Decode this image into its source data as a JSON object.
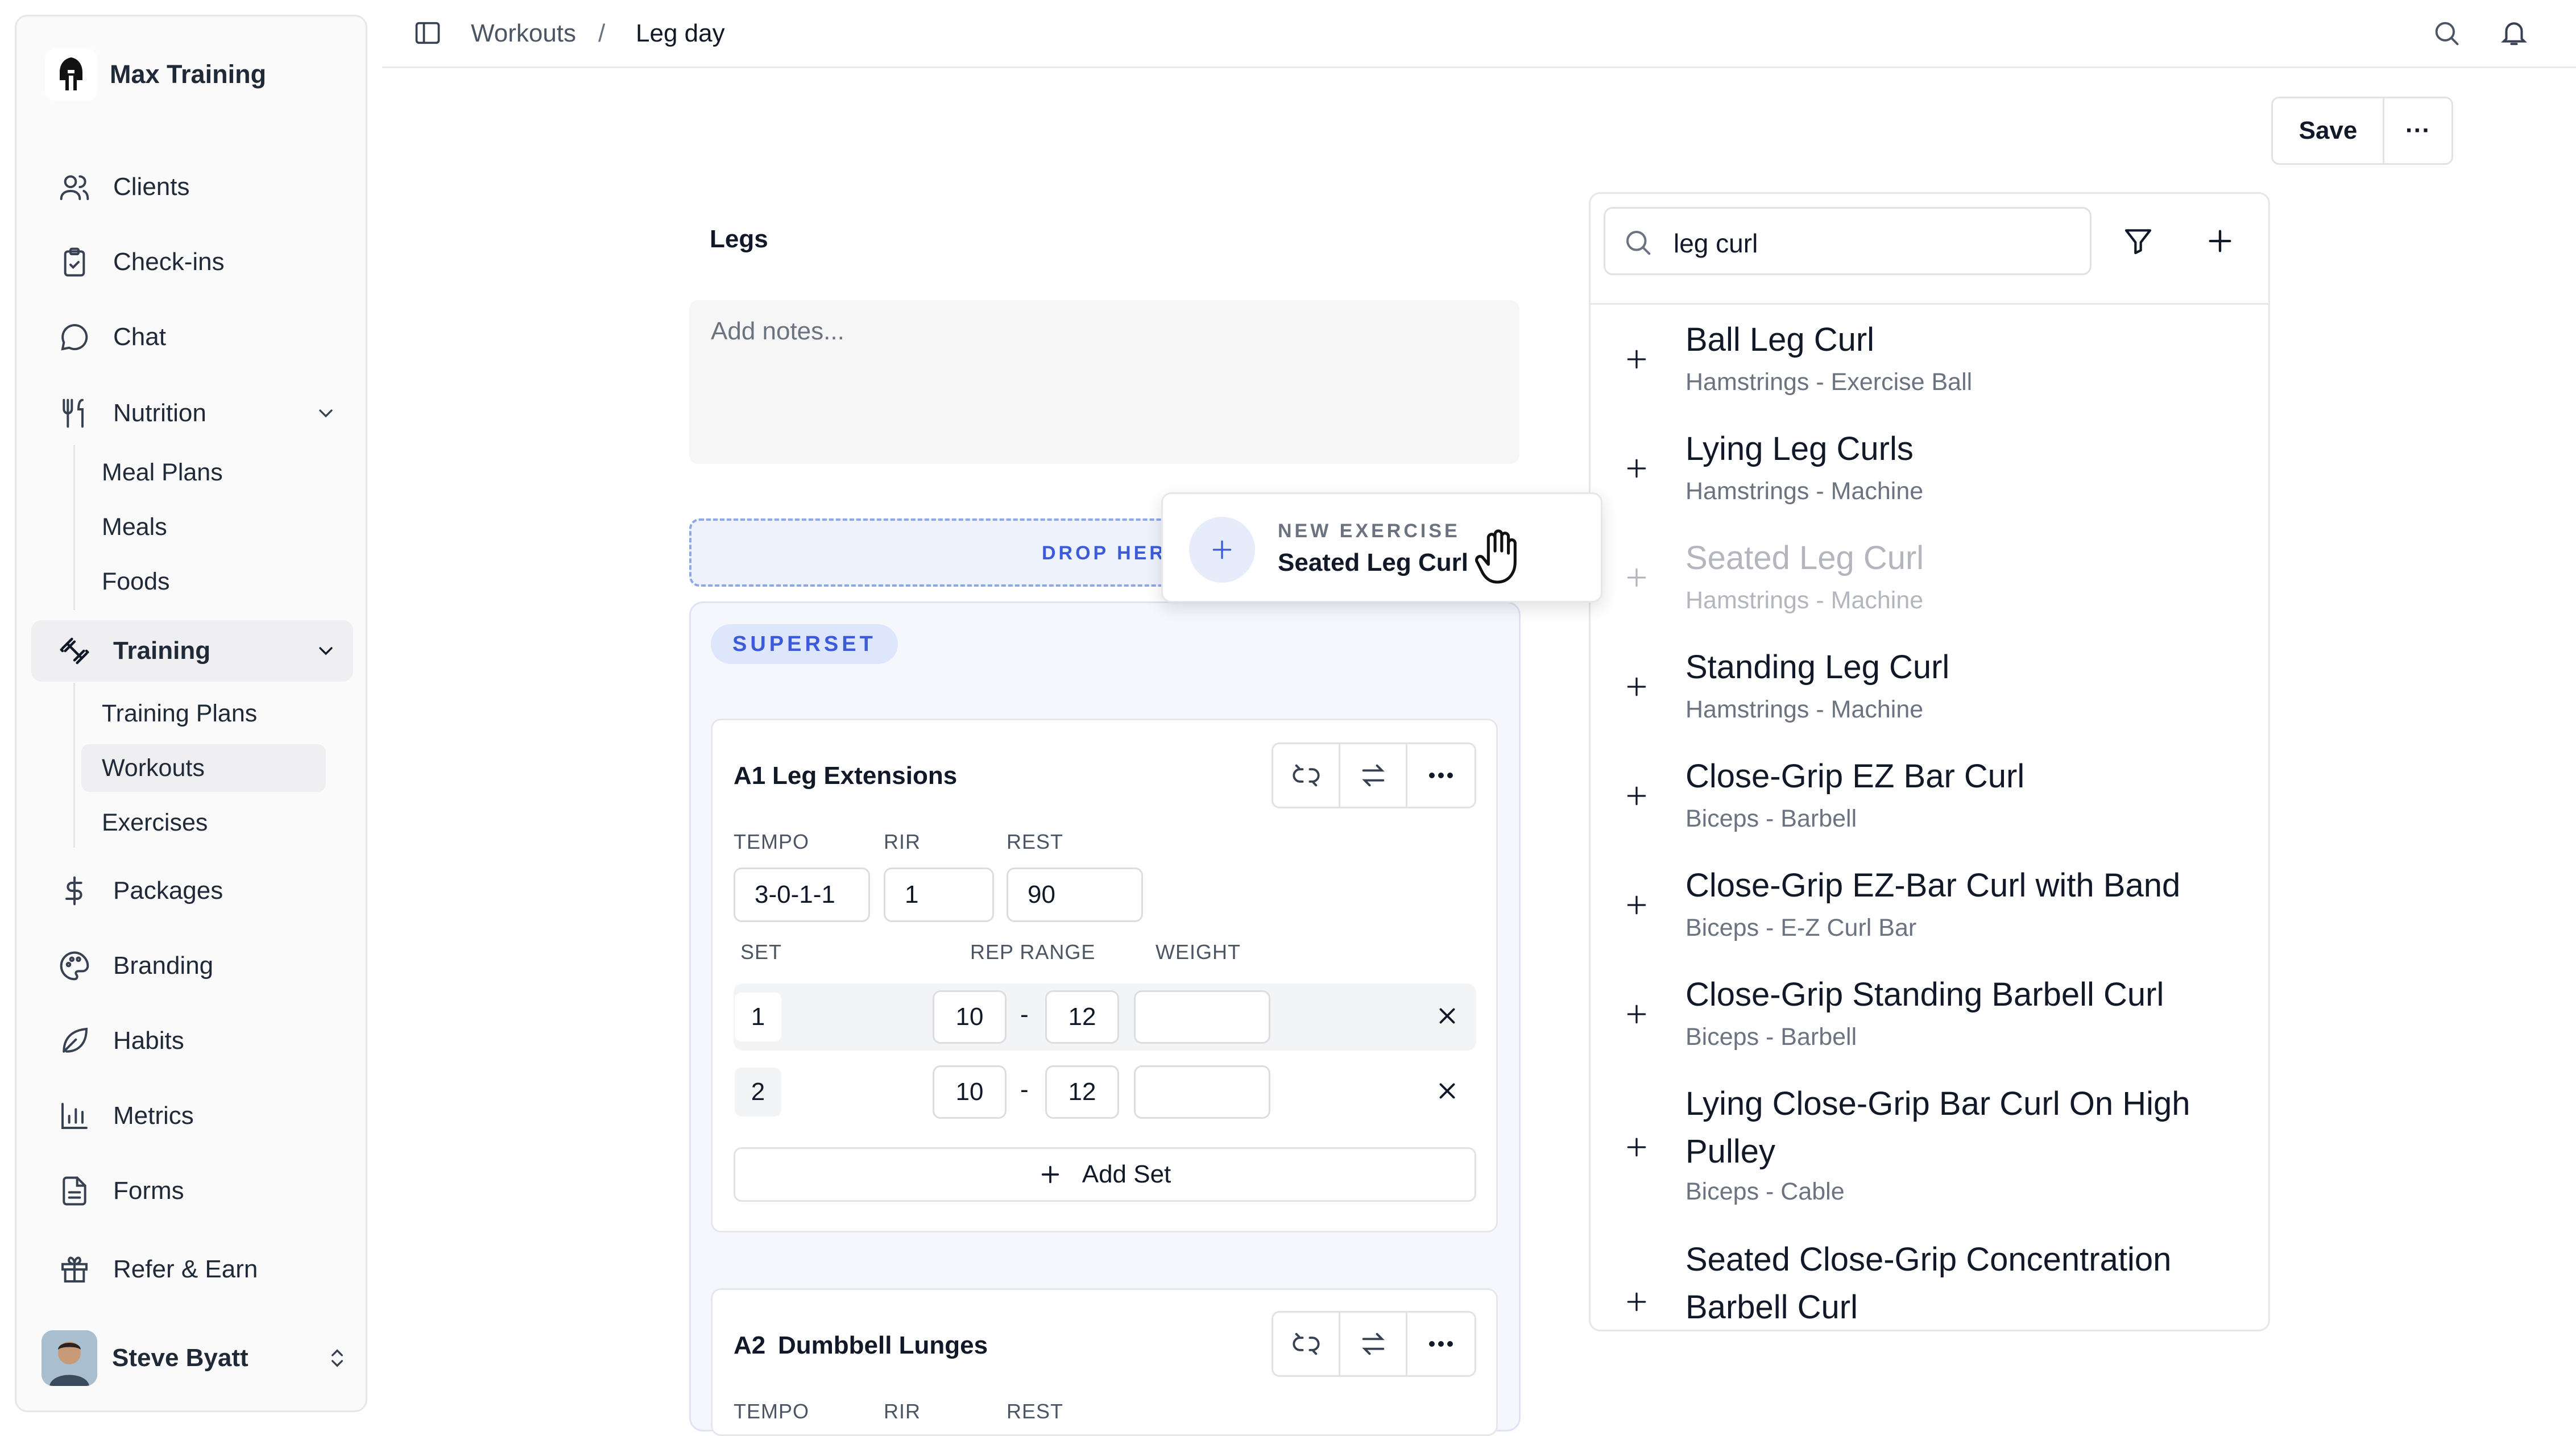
{
  "sidebar": {
    "brand": "Max Training",
    "items": [
      {
        "label": "Clients",
        "icon": "users-icon"
      },
      {
        "label": "Check-ins",
        "icon": "clipboard-check-icon"
      },
      {
        "label": "Chat",
        "icon": "chat-bubble-icon"
      },
      {
        "label": "Nutrition",
        "icon": "utensils-icon"
      },
      {
        "label": "Training",
        "icon": "dumbbell-icon"
      },
      {
        "label": "Packages",
        "icon": "dollar-icon"
      },
      {
        "label": "Branding",
        "icon": "palette-icon"
      },
      {
        "label": "Habits",
        "icon": "leaf-icon"
      },
      {
        "label": "Metrics",
        "icon": "bar-chart-icon"
      },
      {
        "label": "Forms",
        "icon": "document-icon"
      },
      {
        "label": "Refer & Earn",
        "icon": "gift-icon"
      }
    ],
    "nutrition_sub": [
      "Meal Plans",
      "Meals",
      "Foods"
    ],
    "training_sub": [
      "Training Plans",
      "Workouts",
      "Exercises"
    ],
    "user": {
      "name": "Steve Byatt"
    }
  },
  "breadcrumb": {
    "parent": "Workouts",
    "separator": "/",
    "current": "Leg day"
  },
  "toolbar": {
    "save_label": "Save",
    "more_label": "···"
  },
  "workout": {
    "section_title": "Legs",
    "notes_placeholder": "Add notes...",
    "drop_zone_label": "DROP HERE",
    "drag_card": {
      "kicker": "NEW EXERCISE",
      "name": "Seated Leg Curl"
    },
    "superset_badge": "SUPERSET",
    "exercises": [
      {
        "code": "A1",
        "name": "Leg Extensions",
        "tempo_label": "TEMPO",
        "rir_label": "RIR",
        "rest_label": "REST",
        "tempo": "3-0-1-1",
        "rir": "1",
        "rest": "90",
        "set_label": "SET",
        "rep_range_label": "REP RANGE",
        "weight_label": "WEIGHT",
        "sets": [
          {
            "set": "1",
            "min": "10",
            "dash": "-",
            "max": "12",
            "weight": ""
          },
          {
            "set": "2",
            "min": "10",
            "dash": "-",
            "max": "12",
            "weight": ""
          }
        ],
        "add_set_label": "Add Set"
      },
      {
        "code": "A2",
        "name": "Dumbbell Lunges",
        "tempo_label": "TEMPO",
        "rir_label": "RIR",
        "rest_label": "REST"
      }
    ]
  },
  "library": {
    "search_value": "leg curl",
    "results": [
      {
        "name": "Ball Leg Curl",
        "meta": "Hamstrings - Exercise Ball"
      },
      {
        "name": "Lying Leg Curls",
        "meta": "Hamstrings - Machine"
      },
      {
        "name": "Seated Leg Curl",
        "meta": "Hamstrings - Machine"
      },
      {
        "name": "Standing Leg Curl",
        "meta": "Hamstrings - Machine"
      },
      {
        "name": "Close-Grip EZ Bar Curl",
        "meta": "Biceps - Barbell"
      },
      {
        "name": "Close-Grip EZ-Bar Curl with Band",
        "meta": "Biceps - E-Z Curl Bar"
      },
      {
        "name": "Close-Grip Standing Barbell Curl",
        "meta": "Biceps - Barbell"
      },
      {
        "name": "Lying Close-Grip Bar Curl On High Pulley",
        "meta": "Biceps - Cable"
      },
      {
        "name": "Seated Close-Grip Concentration Barbell Curl",
        "meta": ""
      }
    ]
  },
  "colors": {
    "accent": "#3b5bdb",
    "superset_bg": "#f6f7fd",
    "drop_bg": "#eef2fd",
    "badge_bg": "#dde6fb"
  }
}
